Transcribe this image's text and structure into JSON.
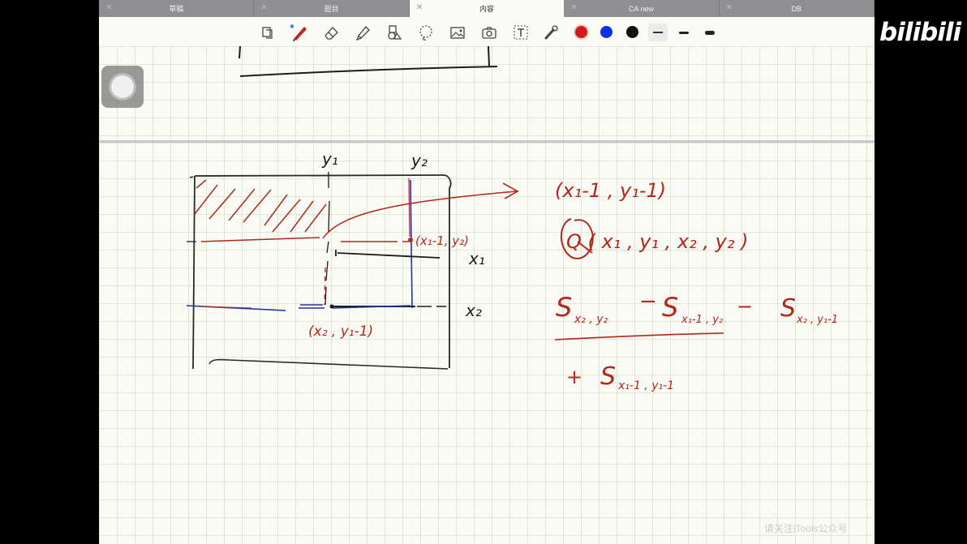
{
  "tabs": [
    {
      "label": "草稿",
      "active": false
    },
    {
      "label": "题目",
      "active": false
    },
    {
      "label": "内容",
      "active": true
    },
    {
      "label": "CA new",
      "active": false
    },
    {
      "label": "DB",
      "active": false
    }
  ],
  "toolbar": {
    "tools": [
      "page-layout-icon",
      "pen-icon",
      "eraser-icon",
      "highlighter-icon",
      "shapes-icon",
      "lasso-icon",
      "image-icon",
      "camera-icon",
      "text-icon",
      "laser-pointer-icon"
    ],
    "colors": [
      "#d21a1a",
      "#1030e0",
      "#111111"
    ],
    "stroke_widths": [
      "thin",
      "medium",
      "thick"
    ]
  },
  "handwriting": {
    "y1": "y₁",
    "y2": "y₂",
    "x1": "x₁",
    "x2": "x₂",
    "cell_label": "(x₁-1, y₂)",
    "bottom_label": "(x₂ , y₁-1)",
    "arrow_target": "(x₁-1 , y₁-1)",
    "query": "Q ( x₁ , y₁ , x₂ , y₂ )",
    "formula_s1": "S",
    "formula_s1_sub": "x₂ , y₂",
    "formula_minus1": "−",
    "formula_s2": "S",
    "formula_s2_sub": "x₁-1 , y₂",
    "formula_minus2": "−",
    "formula_s3": "S",
    "formula_s3_sub": "x₂ , y₁-1",
    "formula_plus": "+",
    "formula_s4": "S",
    "formula_s4_sub": "x₁-1 , y₁-1"
  },
  "watermark": "bilibili",
  "caption": "请关注iTools公众号",
  "colors": {
    "ink_red": "#b3261e",
    "ink_black": "#1b1b1b",
    "ink_blue": "#2233aa",
    "grid": "#dfe6d4"
  }
}
